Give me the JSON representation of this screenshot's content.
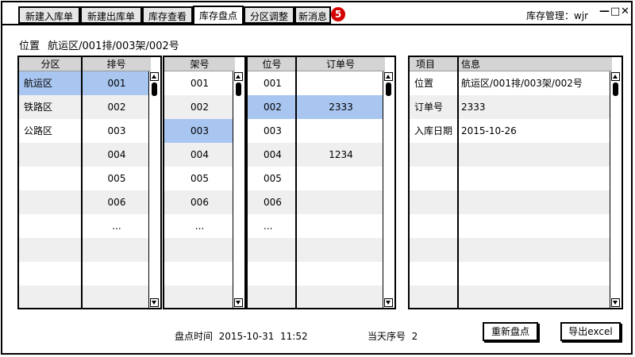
{
  "tabs": [
    {
      "label": "新建入库单",
      "active": false
    },
    {
      "label": "新建出库单",
      "active": false
    },
    {
      "label": "库存查看",
      "active": false
    },
    {
      "label": "库存盘点",
      "active": true
    },
    {
      "label": "分区调整",
      "active": false
    },
    {
      "label": "新消息",
      "active": false
    }
  ],
  "badge_count": "5",
  "user": {
    "label": "库存管理：wjr"
  },
  "window_controls": {
    "minimize": "—",
    "maximize": "□",
    "close": "✕"
  },
  "location": {
    "label": "位置",
    "value": "航运区/001排/003架/002号"
  },
  "zone_panel": {
    "col1_header": "分区",
    "col2_header": "排号",
    "zones": [
      "航运区",
      "铁路区",
      "公路区"
    ],
    "rows": [
      "001",
      "002",
      "003",
      "004",
      "005",
      "006",
      "..."
    ]
  },
  "shelf_panel": {
    "header": "架号",
    "items": [
      "001",
      "002",
      "003",
      "004",
      "005",
      "006",
      "..."
    ]
  },
  "slot_panel": {
    "col1_header": "位号",
    "col2_header": "订单号",
    "slots": [
      "001",
      "002",
      "003",
      "004",
      "005",
      "006",
      "..."
    ],
    "orders": [
      "",
      "2333",
      "",
      "1234",
      "",
      "",
      ""
    ]
  },
  "info_panel": {
    "col1_header": "项目",
    "col2_header": "信息",
    "items": [
      {
        "key": "位置",
        "value": "航运区/001排/003架/002号"
      },
      {
        "key": "订单号",
        "value": "2333"
      },
      {
        "key": "入库日期",
        "value": "2015-10-26"
      }
    ]
  },
  "footer": {
    "time_label": "盘点时间",
    "time_value": "2015-10-31  11:52",
    "seq_label": "当天序号",
    "seq_value": "2",
    "recount_button": "重新盘点",
    "export_button": "导出excel"
  },
  "colors": {
    "selected": "#a9c6f0",
    "alt_row": "#efefef",
    "header": "#d4d4d4",
    "badge": "#d40000"
  }
}
